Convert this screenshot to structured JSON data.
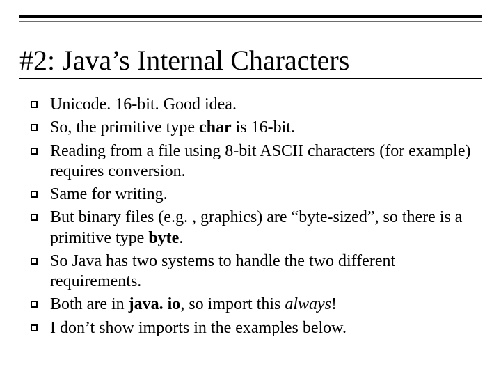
{
  "title": "#2: Java’s Internal Characters",
  "bullets": [
    {
      "segments": [
        {
          "text": "Unicode. 16-bit. Good idea."
        }
      ]
    },
    {
      "segments": [
        {
          "text": "So, the primitive type "
        },
        {
          "text": "char",
          "bold": true
        },
        {
          "text": " is 16-bit."
        }
      ]
    },
    {
      "segments": [
        {
          "text": "Reading from a file using 8-bit ASCII characters (for example) requires conversion."
        }
      ]
    },
    {
      "segments": [
        {
          "text": "Same for writing."
        }
      ]
    },
    {
      "segments": [
        {
          "text": "But binary files (e.g. , graphics) are “byte-sized”, so there is a primitive type "
        },
        {
          "text": "byte",
          "bold": true
        },
        {
          "text": "."
        }
      ]
    },
    {
      "segments": [
        {
          "text": "So Java has two systems to handle the two different requirements."
        }
      ]
    },
    {
      "segments": [
        {
          "text": "Both are in "
        },
        {
          "text": "java. io",
          "bold": true
        },
        {
          "text": ", so import this "
        },
        {
          "text": "always",
          "italic": true
        },
        {
          "text": "!"
        }
      ]
    },
    {
      "segments": [
        {
          "text": "I don’t show imports in the examples below."
        }
      ]
    }
  ]
}
